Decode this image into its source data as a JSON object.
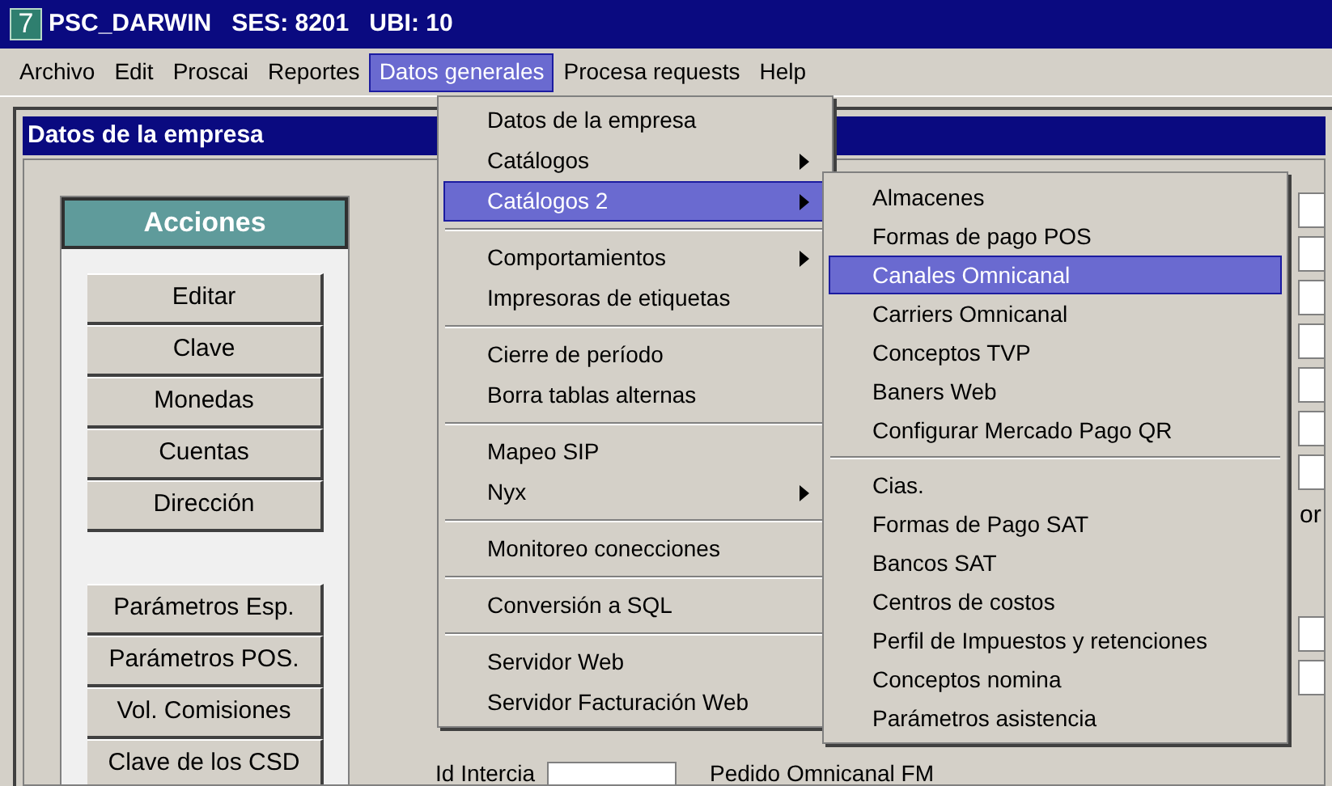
{
  "window": {
    "icon_text": "7",
    "title": "PSC_DARWIN   SES: 8201   UBI: 10"
  },
  "menu_bar": [
    {
      "label": "Archivo",
      "selected": false
    },
    {
      "label": "Edit",
      "selected": false
    },
    {
      "label": "Proscai",
      "selected": false
    },
    {
      "label": "Reportes",
      "selected": false
    },
    {
      "label": "Datos generales",
      "selected": true
    },
    {
      "label": "Procesa requests",
      "selected": false
    },
    {
      "label": "Help",
      "selected": false
    }
  ],
  "child_window": {
    "title": "Datos de la empresa"
  },
  "actions": {
    "title": "Acciones",
    "buttons": [
      "Editar",
      "Clave",
      "Monedas",
      "Cuentas",
      "Dirección"
    ],
    "buttons_2": [
      "Parámetros Esp.",
      "Parámetros POS.",
      "Vol. Comisiones",
      "Clave de los CSD"
    ]
  },
  "form": {
    "cut_label": "or",
    "bottom_labels": [
      "Id Intercia",
      "Pedido Omnicanal FM"
    ]
  },
  "menu": {
    "groups": [
      [
        {
          "label": "Datos de la empresa",
          "submenu": false,
          "selected": false
        },
        {
          "label": "Catálogos",
          "submenu": true,
          "selected": false
        },
        {
          "label": "Catálogos 2",
          "submenu": true,
          "selected": true
        }
      ],
      [
        {
          "label": "Comportamientos",
          "submenu": true,
          "selected": false
        },
        {
          "label": "Impresoras de etiquetas",
          "submenu": false,
          "selected": false
        }
      ],
      [
        {
          "label": "Cierre de período",
          "submenu": false,
          "selected": false
        },
        {
          "label": "Borra tablas alternas",
          "submenu": false,
          "selected": false
        }
      ],
      [
        {
          "label": "Mapeo SIP",
          "submenu": false,
          "selected": false
        },
        {
          "label": "Nyx",
          "submenu": true,
          "selected": false
        }
      ],
      [
        {
          "label": "Monitoreo conecciones",
          "submenu": false,
          "selected": false
        }
      ],
      [
        {
          "label": "Conversión a SQL",
          "submenu": false,
          "selected": false
        }
      ],
      [
        {
          "label": "Servidor Web",
          "submenu": false,
          "selected": false
        },
        {
          "label": "Servidor Facturación Web",
          "submenu": false,
          "selected": false
        }
      ]
    ]
  },
  "submenu": {
    "groups": [
      [
        {
          "label": "Almacenes",
          "selected": false
        },
        {
          "label": "Formas de pago POS",
          "selected": false
        },
        {
          "label": "Canales Omnicanal",
          "selected": true
        },
        {
          "label": "Carriers Omnicanal",
          "selected": false
        },
        {
          "label": "Conceptos TVP",
          "selected": false
        },
        {
          "label": "Baners Web",
          "selected": false
        },
        {
          "label": "Configurar Mercado Pago QR",
          "selected": false
        }
      ],
      [
        {
          "label": "Cias.",
          "selected": false
        },
        {
          "label": "Formas de Pago SAT",
          "selected": false
        },
        {
          "label": "Bancos SAT",
          "selected": false
        },
        {
          "label": "Centros de costos",
          "selected": false
        },
        {
          "label": "Perfil de Impuestos y retenciones",
          "selected": false
        },
        {
          "label": "Conceptos nomina",
          "selected": false
        },
        {
          "label": "Parámetros asistencia",
          "selected": false
        }
      ]
    ]
  }
}
